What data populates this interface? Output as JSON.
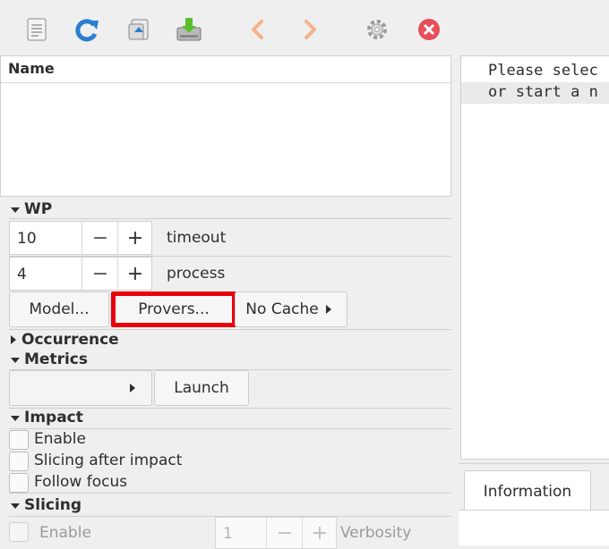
{
  "toolbar": {
    "icons": [
      "new-file-icon",
      "reload-icon",
      "open-icon",
      "save-icon",
      "back-icon",
      "forward-icon",
      "settings-icon",
      "stop-icon"
    ]
  },
  "names_panel": {
    "header": "Name"
  },
  "wp": {
    "title": "WP",
    "timeout": {
      "value": "10",
      "minus": "−",
      "plus": "+",
      "label": "timeout"
    },
    "process": {
      "value": "4",
      "minus": "−",
      "plus": "+",
      "label": "process"
    },
    "model_button": "Model...",
    "provers_button": "Provers...",
    "cache_button": "No Cache",
    "highlight_color": "#e8000d"
  },
  "occurrence": {
    "title": "Occurrence"
  },
  "metrics": {
    "title": "Metrics",
    "launch_button": "Launch"
  },
  "impact": {
    "title": "Impact",
    "options": [
      "Enable",
      "Slicing after impact",
      "Follow focus"
    ]
  },
  "slicing": {
    "title": "Slicing",
    "enable": "Enable",
    "verbosity_value": "1",
    "minus": "−",
    "plus": "+",
    "verbosity_label": "Verbosity"
  },
  "console": {
    "line1": "Please selec",
    "line2": "or start a n"
  },
  "info_tab": {
    "label": "Information"
  }
}
